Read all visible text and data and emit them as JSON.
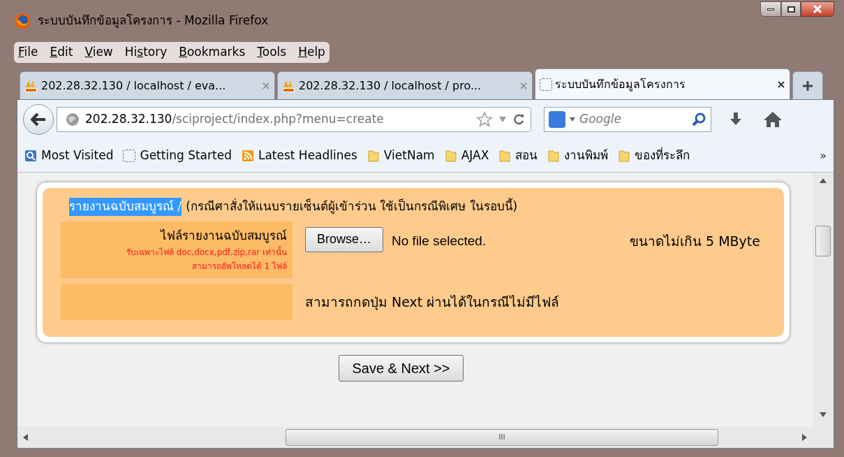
{
  "window": {
    "title": "ระบบบันทึกข้อมูลโครงการ - Mozilla Firefox"
  },
  "menu": [
    {
      "key": "F",
      "after": "ile"
    },
    {
      "key": "E",
      "after": "dit"
    },
    {
      "key": "V",
      "after": "iew"
    },
    {
      "before": "Hi",
      "key": "s",
      "after": "tory"
    },
    {
      "key": "B",
      "after": "ookmarks"
    },
    {
      "key": "T",
      "after": "ools"
    },
    {
      "key": "H",
      "after": "elp"
    }
  ],
  "tabs": [
    {
      "label": "202.28.32.130 / localhost / eva...",
      "kind": "pma",
      "selected": false
    },
    {
      "label": "202.28.32.130 / localhost / pro...",
      "kind": "pma",
      "selected": false
    },
    {
      "label": "ระบบบันทึกข้อมูลโครงการ",
      "kind": "blank",
      "selected": true
    }
  ],
  "address": {
    "host": "202.28.32.130",
    "path": "/sciproject/index.php?menu=create"
  },
  "search": {
    "placeholder": "Google"
  },
  "bookmarks": [
    {
      "label": "Most Visited",
      "kind": "page"
    },
    {
      "label": "Getting Started",
      "kind": "blank"
    },
    {
      "label": "Latest Headlines",
      "kind": "feed"
    },
    {
      "label": "VietNam",
      "kind": "folder"
    },
    {
      "label": "AJAX",
      "kind": "folder"
    },
    {
      "label": "สอน",
      "kind": "folder"
    },
    {
      "label": "งานพิมพ์",
      "kind": "folder"
    },
    {
      "label": "ของที่ระลึก",
      "kind": "folder"
    }
  ],
  "bookmarks_overflow": "»",
  "form": {
    "heading": {
      "label": "รายงานฉบับสมบูรณ์ /",
      "selected": true,
      "note": "(กรณีศาสั่งให้แนบรายเซ็นต์ผู้เข้าร่วน ใช้เป็นกรณีพิเศษ ในรอบนี้)"
    },
    "file_label": "ไฟล์รายงานฉบับสมบูรณ์",
    "hints": [
      "รับเฉพาะไฟล์ doc,docx,pdf,zip,rar เท่านั้น",
      "สามารถอัพโหลดได้ 1 ไฟล์"
    ],
    "browse_button": "Browse…",
    "file_status": "No file selected.",
    "size_note": "ขนาดไม่เกิน 5 MByte",
    "skip_note": "สามารถกดปุ่ม Next ผ่านได้ในกรณีไม่มีไฟล์"
  },
  "submit_button": "Save & Next >>",
  "scrollbar_grip": "III"
}
